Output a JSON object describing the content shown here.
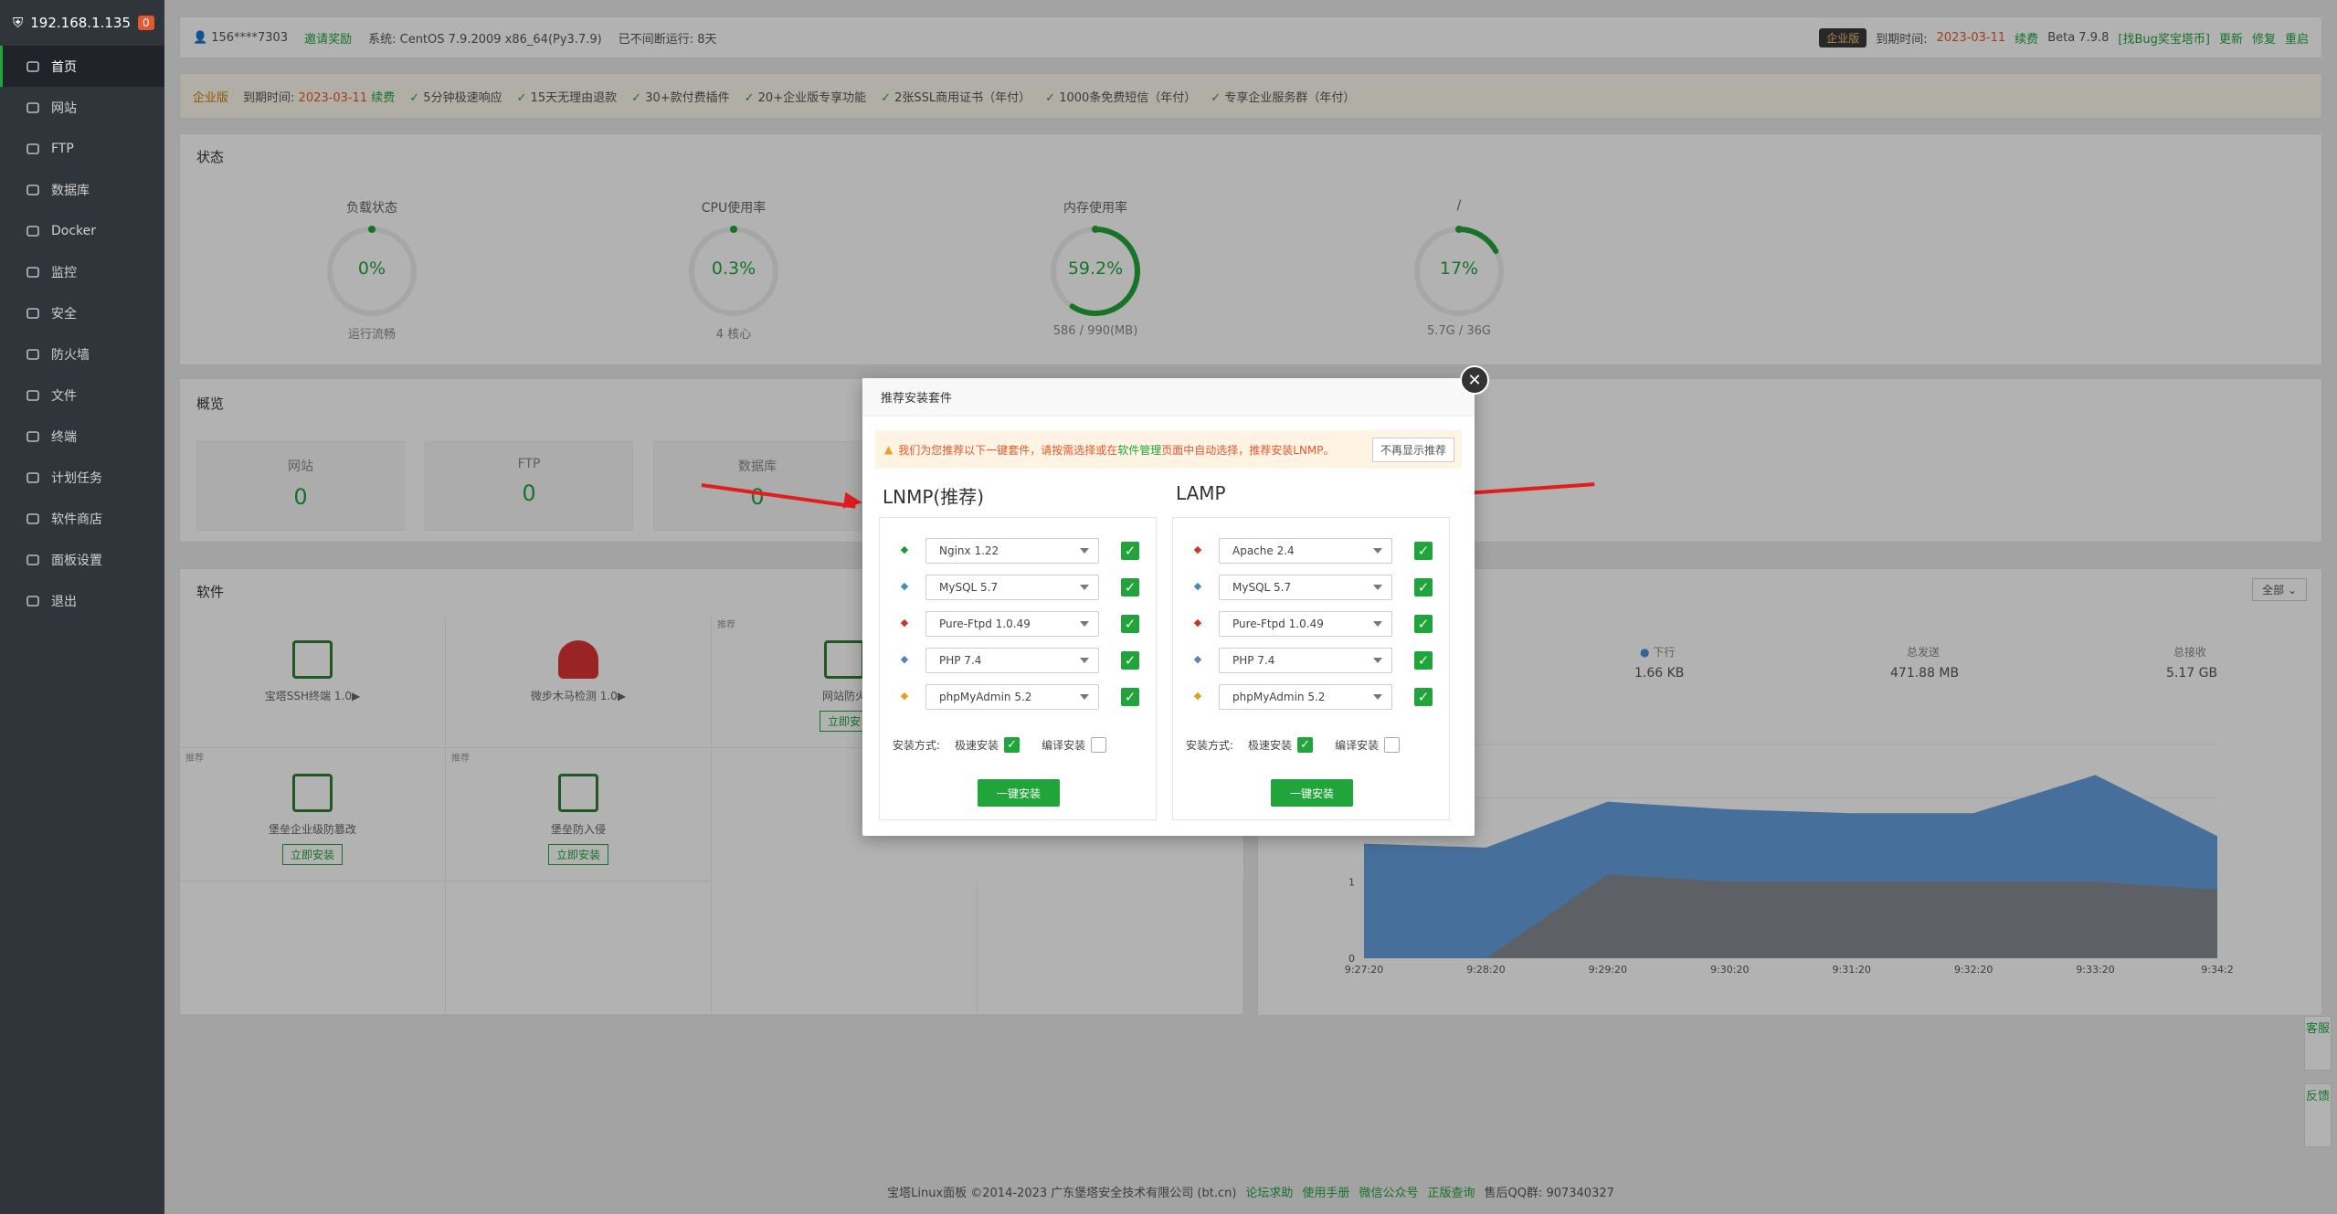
{
  "sidebar": {
    "host": "192.168.1.135",
    "badge": "0",
    "items": [
      {
        "label": "首页",
        "icon": "home-icon"
      },
      {
        "label": "网站",
        "icon": "globe-icon"
      },
      {
        "label": "FTP",
        "icon": "ftp-icon"
      },
      {
        "label": "数据库",
        "icon": "database-icon"
      },
      {
        "label": "Docker",
        "icon": "docker-icon"
      },
      {
        "label": "监控",
        "icon": "monitor-icon"
      },
      {
        "label": "安全",
        "icon": "shield-icon"
      },
      {
        "label": "防火墙",
        "icon": "firewall-icon"
      },
      {
        "label": "文件",
        "icon": "folder-icon"
      },
      {
        "label": "终端",
        "icon": "terminal-icon"
      },
      {
        "label": "计划任务",
        "icon": "clock-icon"
      },
      {
        "label": "软件商店",
        "icon": "grid-icon"
      },
      {
        "label": "面板设置",
        "icon": "settings-icon"
      },
      {
        "label": "退出",
        "icon": "logout-icon"
      }
    ]
  },
  "topbar": {
    "user": "156****7303",
    "invite": "邀请奖励",
    "system": "系统: CentOS 7.9.2009 x86_64(Py3.7.9)",
    "uptime": "已不间断运行: 8天",
    "edition": "企业版",
    "expire_label": "到期时间:",
    "expire_date": "2023-03-11",
    "renew": "续费",
    "version": "Beta 7.9.8",
    "bug_link": "[找Bug奖宝塔币]",
    "update": "更新",
    "repair": "修复",
    "restart": "重启"
  },
  "promo": {
    "edition": "企业版",
    "expire_label": "到期时间:",
    "expire_date": "2023-03-11",
    "renew": "续费",
    "features": [
      "5分钟极速响应",
      "15天无理由退款",
      "30+款付费插件",
      "20+企业版专享功能",
      "2张SSL商用证书（年付）",
      "1000条免费短信（年付）",
      "专享企业服务群（年付）"
    ]
  },
  "status": {
    "title": "状态",
    "gauges": [
      {
        "title": "负载状态",
        "value": "0%",
        "bottom": "运行流畅",
        "fraction": 0.0
      },
      {
        "title": "CPU使用率",
        "value": "0.3%",
        "bottom": "4 核心",
        "fraction": 0.003
      },
      {
        "title": "内存使用率",
        "value": "59.2%",
        "bottom": "586 / 990(MB)",
        "fraction": 0.592
      },
      {
        "title": "/",
        "value": "17%",
        "bottom": "5.7G / 36G",
        "fraction": 0.17
      }
    ]
  },
  "overview": {
    "title": "概览",
    "cards": [
      {
        "label": "网站",
        "value": "0"
      },
      {
        "label": "FTP",
        "value": "0"
      },
      {
        "label": "数据库",
        "value": "0"
      }
    ]
  },
  "software": {
    "title": "软件",
    "items": [
      {
        "name": "宝塔SSH终端 1.0▶",
        "tag": ""
      },
      {
        "name": "微步木马检测 1.0▶",
        "tag": ""
      },
      {
        "name": "网站防火",
        "tag": "推荐",
        "action": "立即安"
      },
      {
        "name": "堡垒企业级防篡改",
        "tag": "推荐",
        "action": "立即安装"
      },
      {
        "name": "堡垒防入侵",
        "tag": "推荐",
        "action": "立即安装"
      }
    ]
  },
  "traffic": {
    "filter": "全部",
    "down_label": "下行",
    "down_value": "1.66 KB",
    "sent_label": "总发送",
    "sent_value": "471.88 MB",
    "recv_label": "总接收",
    "recv_value": "5.17 GB",
    "chart_data": {
      "type": "area",
      "x": [
        "9:27:20",
        "9:28:20",
        "9:29:20",
        "9:30:20",
        "9:31:20",
        "9:32:20",
        "9:33:20",
        "9:34:2"
      ],
      "ylim": [
        0,
        2
      ],
      "yticks": [
        "0",
        "1",
        "2"
      ],
      "series": [
        {
          "values": [
            1.5,
            1.45,
            2.05,
            1.95,
            1.9,
            1.9,
            2.4,
            1.6
          ],
          "color": "#4a90d9"
        },
        {
          "values": [
            0,
            0,
            1.1,
            1.0,
            1.0,
            1.0,
            1.0,
            0.9
          ],
          "color": "#8a8a8a"
        }
      ]
    }
  },
  "dialog": {
    "title": "推荐安装套件",
    "warning_pre": "我们为您推荐以下一键套件，请按需选择或在",
    "warning_link": "软件管理",
    "warning_post": "页面中自动选择，推荐安装LNMP。",
    "no_show": "不再显示推荐",
    "columns": [
      {
        "title": "LNMP(推荐)",
        "rows": [
          {
            "icon": "nginx-icon",
            "value": "Nginx 1.22"
          },
          {
            "icon": "mysql-icon",
            "value": "MySQL 5.7"
          },
          {
            "icon": "ftp-icon",
            "value": "Pure-Ftpd 1.0.49"
          },
          {
            "icon": "php-icon",
            "value": "PHP 7.4"
          },
          {
            "icon": "phpmyadmin-icon",
            "value": "phpMyAdmin 5.2"
          }
        ],
        "method_label": "安装方式:",
        "fast": "极速安装",
        "compile": "编译安装",
        "install": "一键安装"
      },
      {
        "title": "LAMP",
        "rows": [
          {
            "icon": "apache-icon",
            "value": "Apache 2.4"
          },
          {
            "icon": "mysql-icon",
            "value": "MySQL 5.7"
          },
          {
            "icon": "ftp-icon",
            "value": "Pure-Ftpd 1.0.49"
          },
          {
            "icon": "php-icon",
            "value": "PHP 7.4"
          },
          {
            "icon": "phpmyadmin-icon",
            "value": "phpMyAdmin 5.2"
          }
        ],
        "method_label": "安装方式:",
        "fast": "极速安装",
        "compile": "编译安装",
        "install": "一键安装"
      }
    ]
  },
  "side_tabs": [
    "客服",
    "反馈"
  ],
  "footer": {
    "copyright": "宝塔Linux面板 ©2014-2023 广东堡塔安全技术有限公司 (bt.cn)",
    "links": [
      "论坛求助",
      "使用手册",
      "微信公众号",
      "正版查询"
    ],
    "qq": "售后QQ群: 907340327"
  }
}
